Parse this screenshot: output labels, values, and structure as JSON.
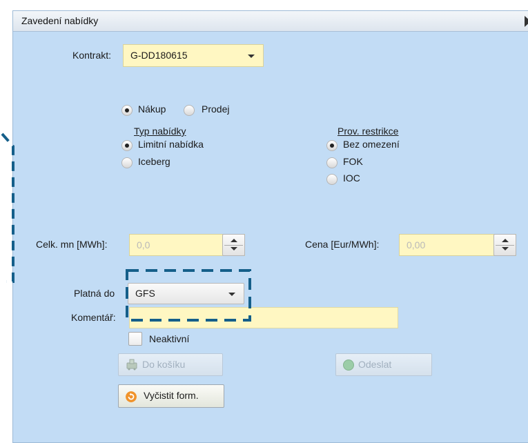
{
  "panel": {
    "title": "Zavedení nabídky"
  },
  "contract": {
    "label": "Kontrakt:",
    "value": "G-DD180615"
  },
  "direction": {
    "buy_label": "Nákup",
    "sell_label": "Prodej",
    "selected": "buy"
  },
  "offer_type": {
    "header": "Typ nabídky",
    "options": [
      "Limitní nabídka",
      "Iceberg"
    ],
    "selected": 0
  },
  "restriction": {
    "header": "Prov. restrikce",
    "options": [
      "Bez omezení",
      "FOK",
      "IOC"
    ],
    "selected": 0
  },
  "quantity": {
    "label": "Celk. mn [MWh]:",
    "value": "0,0"
  },
  "price": {
    "label": "Cena [Eur/MWh]:",
    "value": "0,00"
  },
  "valid_until": {
    "label": "Platná do",
    "value": "GFS"
  },
  "comment": {
    "label": "Komentář:",
    "value": ""
  },
  "inactive": {
    "label": "Neaktivní",
    "checked": false
  },
  "buttons": {
    "cart": "Do košíku",
    "send": "Odeslat",
    "clear": "Vyčistit form."
  },
  "colors": {
    "panel_bg": "#c2dcf5",
    "field_bg": "#fff7c2",
    "annotation": "#155f8a",
    "clear_icon": "#f0932b",
    "send_icon": "#8fc88f"
  }
}
